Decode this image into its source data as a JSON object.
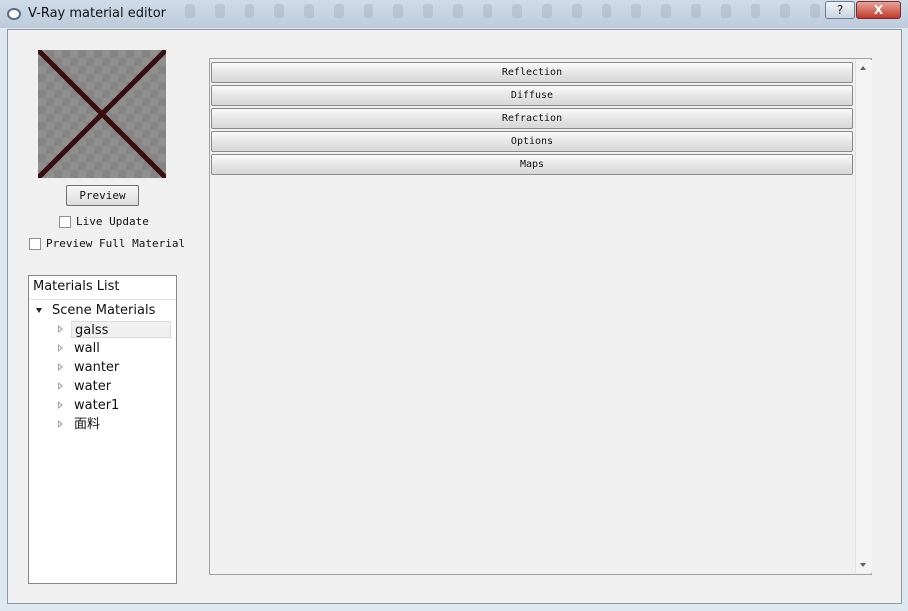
{
  "window": {
    "title": "V-Ray material editor",
    "help_label": "?",
    "close_label": "X"
  },
  "preview": {
    "button_label": "Preview",
    "live_update_label": "Live Update",
    "preview_full_label": "Preview Full Material"
  },
  "materials": {
    "header": "Materials List",
    "root_label": "Scene Materials",
    "items": [
      {
        "label": "galss"
      },
      {
        "label": "wall"
      },
      {
        "label": "wanter"
      },
      {
        "label": "water"
      },
      {
        "label": "water1"
      },
      {
        "label": "面料"
      }
    ]
  },
  "rollouts": [
    {
      "label": "Reflection"
    },
    {
      "label": "Diffuse"
    },
    {
      "label": "Refraction"
    },
    {
      "label": "Options"
    },
    {
      "label": "Maps"
    }
  ]
}
